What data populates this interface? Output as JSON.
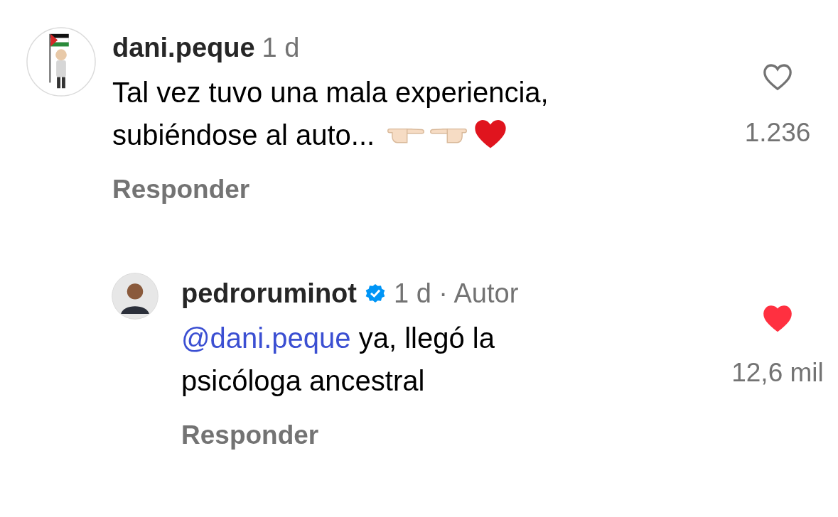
{
  "comments": [
    {
      "kind": "comment",
      "username": "dani.peque",
      "verified": false,
      "time": "1 d",
      "lines": [
        "Tal vez tuvo una mala experiencia,",
        "subiéndose al auto..."
      ],
      "emoji_trail": true,
      "likes": "1.236",
      "liked": false,
      "reply_label": "Responder"
    },
    {
      "kind": "reply",
      "username": "pedroruminot",
      "verified": true,
      "time": "1 d",
      "separator": "·",
      "author_label": "Autor",
      "mention": "@dani.peque",
      "lines": [
        "ya, llegó la",
        "psicóloga ancestral"
      ],
      "emoji_trail": false,
      "likes": "12,6 mil",
      "liked": true,
      "reply_label": "Responder"
    }
  ]
}
